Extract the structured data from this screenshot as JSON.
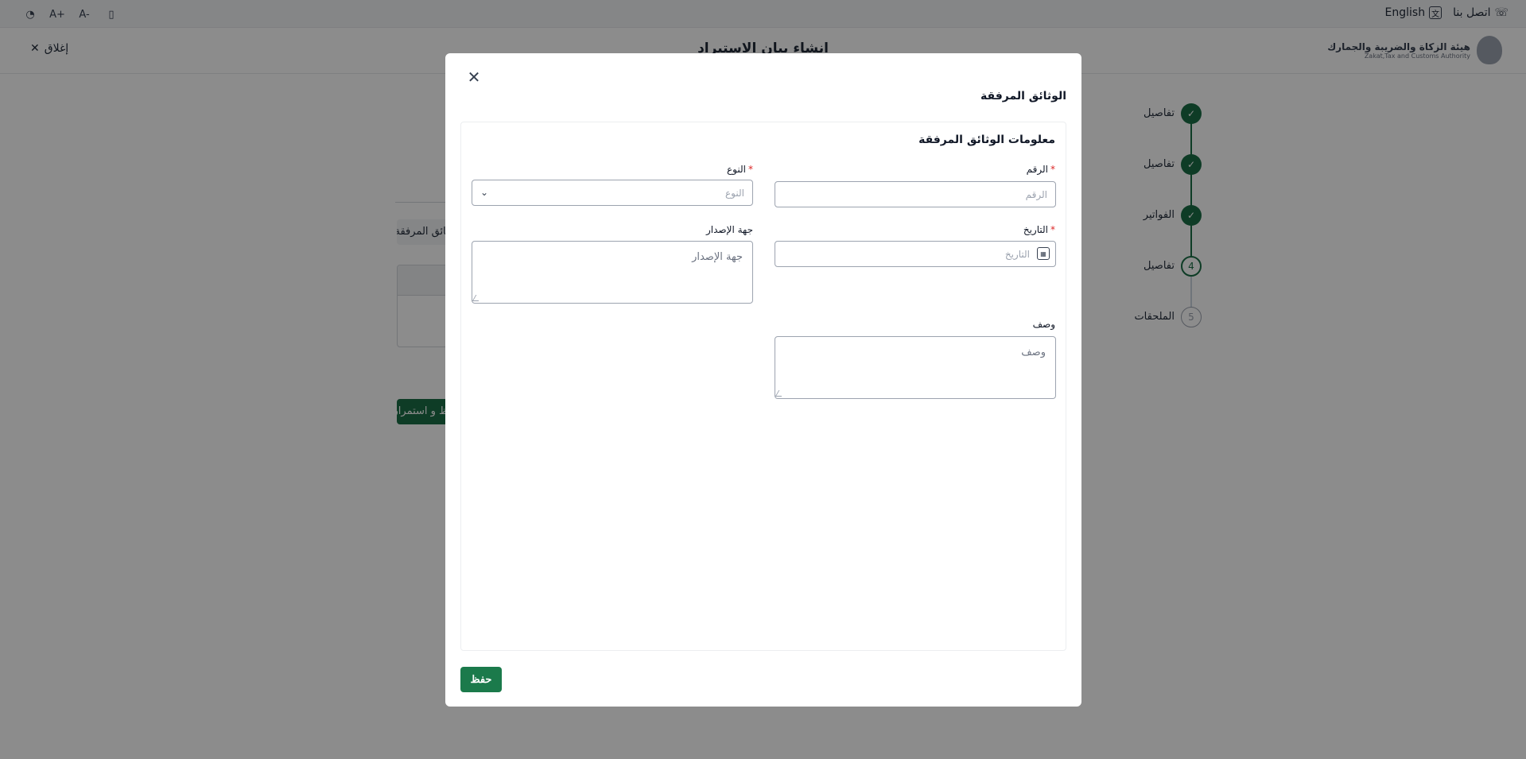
{
  "topbar": {
    "contact_label": "اتصل بنا",
    "language_label": "English",
    "tools": [
      {
        "icon": "palette-icon",
        "glyph": "◔"
      },
      {
        "icon": "font-increase-icon",
        "glyph": "A+"
      },
      {
        "icon": "font-decrease-icon",
        "glyph": "A-"
      },
      {
        "icon": "mobile-icon",
        "glyph": "▯"
      }
    ]
  },
  "header": {
    "close_label": "إغلاق",
    "page_title": "انشاء بيان الاستيراد",
    "logo_ar": "هيئة الزكاة والضريبة والجمارك",
    "logo_en": "Zakat,Tax and Customs Authority"
  },
  "stepper": {
    "steps": [
      {
        "number": "",
        "label": "تفاصيل",
        "state": "done"
      },
      {
        "number": "",
        "label": "تفاصيل",
        "state": "done"
      },
      {
        "number": "",
        "label": "الفواتير",
        "state": "done"
      },
      {
        "number": "4",
        "label": "تفاصيل",
        "state": "current"
      },
      {
        "number": "5",
        "label": "الملحقات",
        "state": "pending"
      }
    ]
  },
  "background": {
    "tab_label": "الوثائق المرفقة",
    "continue_button": "حفظ و استمرار"
  },
  "modal": {
    "title": "الوثائق المرفقة",
    "section_title": "معلومات الوثائق المرفقة",
    "fields": {
      "number": {
        "label": "الرقم",
        "placeholder": "الرقم",
        "required": "*"
      },
      "type": {
        "label": "النوع",
        "placeholder": "النوع",
        "required": "*"
      },
      "date": {
        "label": "التاريخ",
        "placeholder": "التاريخ",
        "required": "*"
      },
      "issuer": {
        "label": "جهة الإصدار",
        "placeholder": "جهة الإصدار"
      },
      "description": {
        "label": "وصف",
        "placeholder": "وصف"
      }
    },
    "save_label": "حفظ"
  }
}
